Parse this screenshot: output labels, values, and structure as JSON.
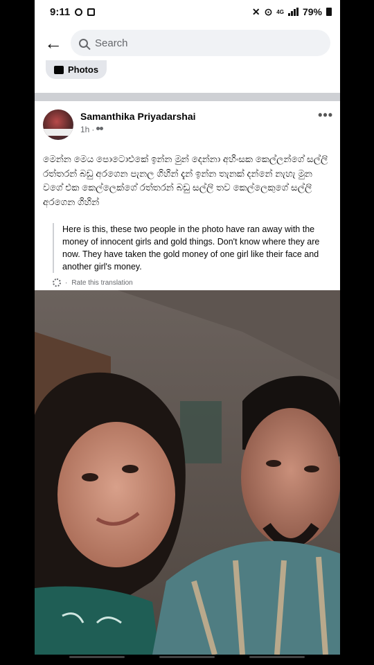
{
  "status_bar": {
    "time": "9:11",
    "network": "4G",
    "battery": "79%"
  },
  "search": {
    "placeholder": "Search"
  },
  "chip": {
    "label": "Photos"
  },
  "post": {
    "author": "Samanthika Priyadarshai",
    "time": "1h",
    "privacy_icon": "friends-icon",
    "text": "මෙන්න මෙය පොටොඑකේ ඉන්න මුන් දෙන්නා අහිංසක කෙල්ලන්ගේ සල්ලි රත්තරන් බඩු අරගෙන පැනල ගිහින් දැන් ඉන්න තැනක් දන්නේ නැහැ මුන වගේ එක කෙල්ලෙක්ගේ රත්තරන් බඩු සල්ලි තව කෙල්ලෙකුගේ සල්ලි අරගෙන ගිහින්",
    "translation": "Here is this, these two people in the photo have ran away with the money of innocent girls and gold things. Don't know where they are now. They have taken the gold money of one girl like their face and another girl's money.",
    "rate_label": "Rate this translation"
  },
  "colors": {
    "search_bg": "#f0f2f5",
    "divider": "#ced0d4",
    "meta_text": "#65676b"
  }
}
